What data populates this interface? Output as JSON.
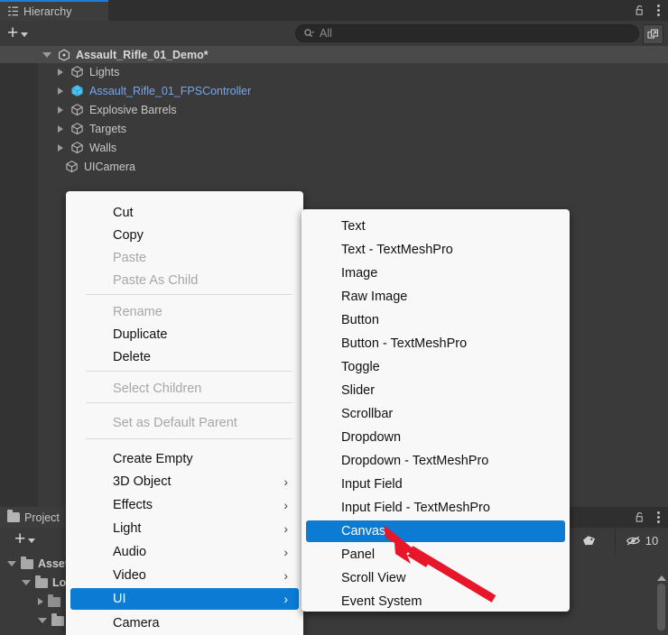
{
  "hierarchy": {
    "tab_label": "Hierarchy",
    "tab_icon": "hierarchy-icon",
    "lock_icon": "lock-open-icon",
    "menu_icon": "kebab-menu-icon",
    "add_button_label": "+",
    "search": {
      "placeholder": "All",
      "icon": "search-icon"
    },
    "popout_icon": "popout-icon",
    "rows": [
      {
        "label": "Assault_Rifle_01_Demo*",
        "icon": "unity-scene-icon",
        "depth": 0,
        "expanded": true,
        "style": "scene"
      },
      {
        "label": "Lights",
        "icon": "gameobject-cube-icon",
        "depth": 1,
        "expanded": false,
        "style": "normal"
      },
      {
        "label": "Assault_Rifle_01_FPSController",
        "icon": "prefab-cube-icon",
        "depth": 1,
        "expanded": false,
        "style": "prefab",
        "has_chevron": true
      },
      {
        "label": "Explosive Barrels",
        "icon": "gameobject-cube-icon",
        "depth": 1,
        "expanded": false,
        "style": "normal"
      },
      {
        "label": "Targets",
        "icon": "gameobject-cube-icon",
        "depth": 1,
        "expanded": false,
        "style": "normal"
      },
      {
        "label": "Walls",
        "icon": "gameobject-cube-icon",
        "depth": 1,
        "expanded": false,
        "style": "normal"
      },
      {
        "label": "UICamera",
        "icon": "gameobject-cube-icon",
        "depth": 1,
        "expanded": null,
        "style": "normal"
      }
    ]
  },
  "project": {
    "tab_label": "Project",
    "tab_icon": "folder-icon",
    "lock_icon": "lock-open-icon",
    "menu_icon": "kebab-menu-icon",
    "add_button_label": "+",
    "toolbar_buttons": [
      {
        "name": "object-filter-icon",
        "label": ""
      },
      {
        "name": "label-tag-icon",
        "label": ""
      },
      {
        "name": "hidden-count-icon",
        "label": "10"
      }
    ],
    "tree": [
      {
        "label": "Assets",
        "depth": 0,
        "expanded": true,
        "icon": "folder-icon"
      },
      {
        "label": "Lo",
        "depth": 1,
        "expanded": true,
        "icon": "folder-icon"
      },
      {
        "label": "",
        "depth": 2,
        "expanded": false,
        "icon": "folder-icon"
      },
      {
        "label": "",
        "depth": 2,
        "expanded": true,
        "icon": "folder-icon"
      }
    ]
  },
  "context_menu": {
    "items": [
      {
        "label": "Cut",
        "state": "enabled"
      },
      {
        "label": "Copy",
        "state": "enabled"
      },
      {
        "label": "Paste",
        "state": "disabled"
      },
      {
        "label": "Paste As Child",
        "state": "disabled"
      },
      {
        "separator_after": true
      },
      {
        "label": "Rename",
        "state": "disabled"
      },
      {
        "label": "Duplicate",
        "state": "enabled"
      },
      {
        "label": "Delete",
        "state": "enabled"
      },
      {
        "separator_after": true
      },
      {
        "label": "Select Children",
        "state": "disabled"
      },
      {
        "separator_after": true
      },
      {
        "label": "Set as Default Parent",
        "state": "disabled"
      },
      {
        "separator_after": true
      },
      {
        "label": "Create Empty",
        "state": "enabled"
      },
      {
        "label": "3D Object",
        "state": "enabled",
        "submenu": true
      },
      {
        "label": "Effects",
        "state": "enabled",
        "submenu": true
      },
      {
        "label": "Light",
        "state": "enabled",
        "submenu": true
      },
      {
        "label": "Audio",
        "state": "enabled",
        "submenu": true
      },
      {
        "label": "Video",
        "state": "enabled",
        "submenu": true
      },
      {
        "label": "UI",
        "state": "selected",
        "submenu": true
      },
      {
        "label": "Camera",
        "state": "enabled"
      }
    ]
  },
  "ui_submenu": {
    "items": [
      {
        "label": "Text",
        "state": "enabled"
      },
      {
        "label": "Text - TextMeshPro",
        "state": "enabled"
      },
      {
        "label": "Image",
        "state": "enabled"
      },
      {
        "label": "Raw Image",
        "state": "enabled"
      },
      {
        "label": "Button",
        "state": "enabled"
      },
      {
        "label": "Button - TextMeshPro",
        "state": "enabled"
      },
      {
        "label": "Toggle",
        "state": "enabled"
      },
      {
        "label": "Slider",
        "state": "enabled"
      },
      {
        "label": "Scrollbar",
        "state": "enabled"
      },
      {
        "label": "Dropdown",
        "state": "enabled"
      },
      {
        "label": "Dropdown - TextMeshPro",
        "state": "enabled"
      },
      {
        "label": "Input Field",
        "state": "enabled"
      },
      {
        "label": "Input Field - TextMeshPro",
        "state": "enabled"
      },
      {
        "label": "Canvas",
        "state": "selected"
      },
      {
        "label": "Panel",
        "state": "enabled"
      },
      {
        "label": "Scroll View",
        "state": "enabled"
      },
      {
        "label": "Event System",
        "state": "enabled"
      }
    ]
  },
  "annotation": {
    "arrow_color": "#e8162a",
    "points_to": "Canvas"
  },
  "colors": {
    "accent_blue": "#0b7bd4",
    "panel_bg": "#3a3a3a",
    "tabbar_bg": "#2f2f2f",
    "menu_bg": "#f8f8f8",
    "prefab_text": "#77a7ea"
  }
}
